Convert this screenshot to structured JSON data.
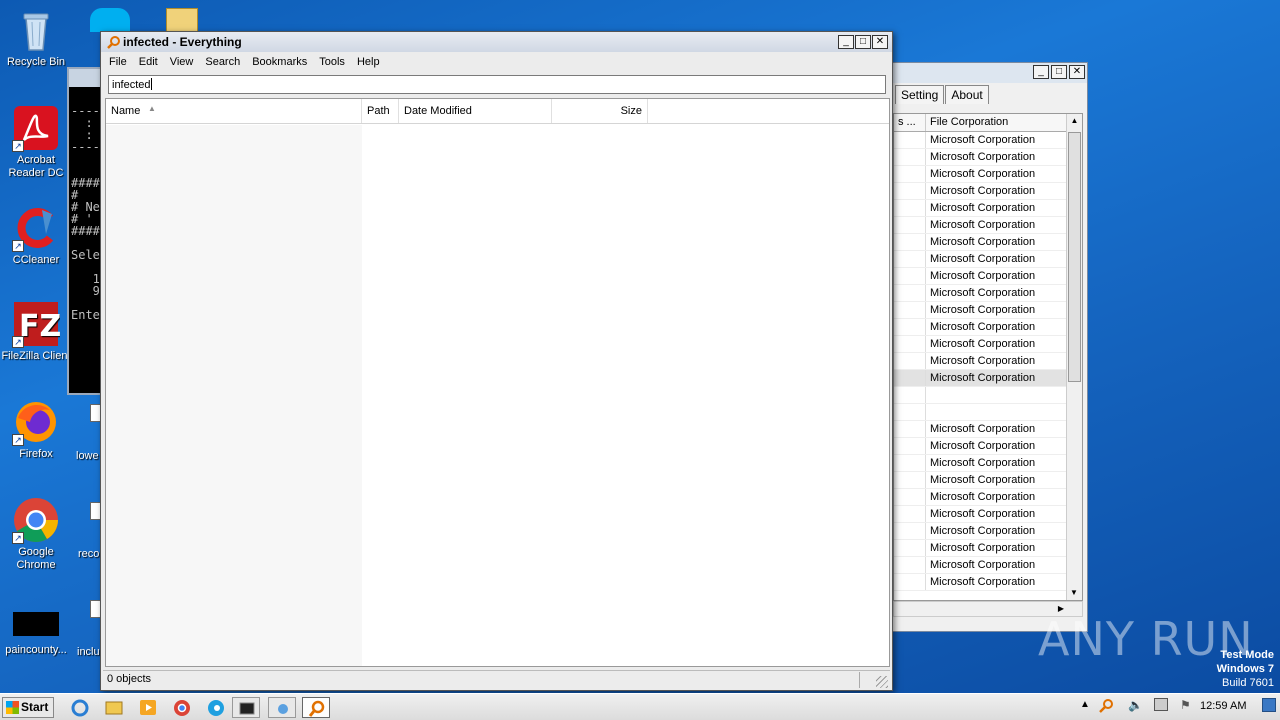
{
  "desktop": {
    "icons": [
      {
        "label": "Recycle Bin"
      },
      {
        "label": "Acrobat Reader DC"
      },
      {
        "label": "CCleaner"
      },
      {
        "label": "FileZilla Client"
      },
      {
        "label": "Firefox"
      },
      {
        "label": "Google Chrome"
      },
      {
        "label": "paincounty..."
      }
    ],
    "partial_labels": [
      "lowe",
      "reco",
      "inclu"
    ]
  },
  "cmd_window": {
    "lines": [
      "",
      "-----",
      "  :",
      "  :",
      "-----",
      "",
      "",
      "####",
      "#",
      "# Ne",
      "# '",
      "####",
      "",
      "Sele",
      "",
      "   1",
      "   9",
      "",
      "Ente"
    ]
  },
  "process_window": {
    "tabs": [
      "Setting",
      "About"
    ],
    "header_left": "s ...",
    "header_col": "File Corporation",
    "rows": [
      "Microsoft Corporation",
      "Microsoft Corporation",
      "Microsoft Corporation",
      "Microsoft Corporation",
      "Microsoft Corporation",
      "Microsoft Corporation",
      "Microsoft Corporation",
      "Microsoft Corporation",
      "Microsoft Corporation",
      "Microsoft Corporation",
      "Microsoft Corporation",
      "Microsoft Corporation",
      "Microsoft Corporation",
      "Microsoft Corporation",
      "Microsoft Corporation",
      "",
      "",
      "Microsoft Corporation",
      "Microsoft Corporation",
      "Microsoft Corporation",
      "Microsoft Corporation",
      "Microsoft Corporation",
      "Microsoft Corporation",
      "Microsoft Corporation",
      "Microsoft Corporation",
      "Microsoft Corporation",
      "Microsoft Corporation"
    ],
    "selected_index": 14
  },
  "main_window": {
    "title": "infected - Everything",
    "menu": [
      "File",
      "Edit",
      "View",
      "Search",
      "Bookmarks",
      "Tools",
      "Help"
    ],
    "search_value": "infected",
    "columns": [
      "Name",
      "Path",
      "Date Modified",
      "Size"
    ],
    "status": "0 objects"
  },
  "watermark": "ANY RUN",
  "test_mode": {
    "line1": "Test Mode",
    "line2": "Windows 7",
    "line3": "Build 7601"
  },
  "taskbar": {
    "start_label": "Start",
    "clock": "12:59 AM"
  }
}
